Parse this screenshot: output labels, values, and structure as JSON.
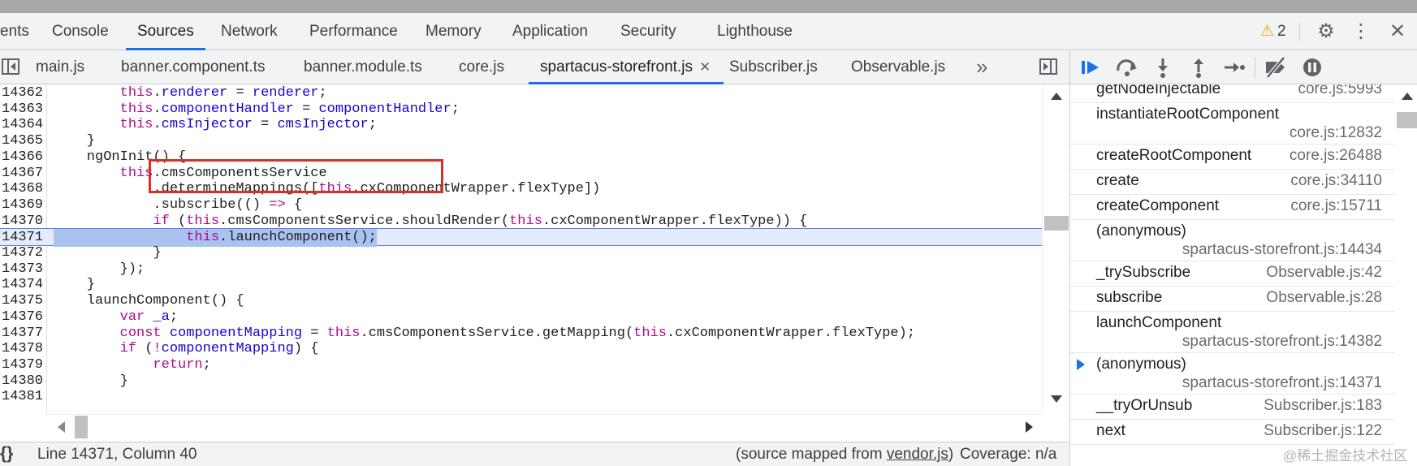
{
  "main_tabs": [
    "ents",
    "Console",
    "Sources",
    "Network",
    "Performance",
    "Memory",
    "Application",
    "Security",
    "Lighthouse"
  ],
  "active_main_tab": "Sources",
  "warnings_count": "2",
  "file_tabs": [
    "main.js",
    "banner.component.ts",
    "banner.module.ts",
    "core.js",
    "spartacus-storefront.js",
    "Subscriber.js",
    "Observable.js"
  ],
  "active_file_tab": "spartacus-storefront.js",
  "more_tabs_glyph": "»",
  "code_lines": [
    {
      "num": "14362",
      "code": "        this.renderer = renderer;"
    },
    {
      "num": "14363",
      "code": "        this.componentHandler = componentHandler;"
    },
    {
      "num": "14364",
      "code": "        this.cmsInjector = cmsInjector;"
    },
    {
      "num": "14365",
      "code": "    }"
    },
    {
      "num": "14366",
      "code": "    ngOnInit() {"
    },
    {
      "num": "14367",
      "code": "        this.cmsComponentsService"
    },
    {
      "num": "14368",
      "code": "            .determineMappings([this.cxComponentWrapper.flexType])"
    },
    {
      "num": "14369",
      "code": "            .subscribe(() => {"
    },
    {
      "num": "14370",
      "code": "            if (this.cmsComponentsService.shouldRender(this.cxComponentWrapper.flexType)) {"
    },
    {
      "num": "14371",
      "code": "                this.launchComponent();"
    },
    {
      "num": "14372",
      "code": "            }"
    },
    {
      "num": "14373",
      "code": "        });"
    },
    {
      "num": "14374",
      "code": "    }"
    },
    {
      "num": "14375",
      "code": "    launchComponent() {"
    },
    {
      "num": "14376",
      "code": "        var _a;"
    },
    {
      "num": "14377",
      "code": "        const componentMapping = this.cmsComponentsService.getMapping(this.cxComponentWrapper.flexType);"
    },
    {
      "num": "14378",
      "code": "        if (!componentMapping) {"
    },
    {
      "num": "14379",
      "code": "            return;"
    },
    {
      "num": "14380",
      "code": "        }"
    },
    {
      "num": "14381",
      "code": ""
    }
  ],
  "paused_line": "14371",
  "status": {
    "braces": "{}",
    "position": "Line 14371, Column 40",
    "source_prefix": "(source mapped from ",
    "source_file": "vendor.js",
    "source_suffix": ")",
    "coverage": "Coverage: n/a"
  },
  "call_stack": [
    {
      "fn": "getNodeInjectable",
      "loc": "core.js:5993",
      "wrap": false,
      "current": false
    },
    {
      "fn": "instantiateRootComponent",
      "loc": "core.js:12832",
      "wrap": true,
      "current": false
    },
    {
      "fn": "createRootComponent",
      "loc": "core.js:26488",
      "wrap": false,
      "current": false
    },
    {
      "fn": "create",
      "loc": "core.js:34110",
      "wrap": false,
      "current": false
    },
    {
      "fn": "createComponent",
      "loc": "core.js:15711",
      "wrap": false,
      "current": false
    },
    {
      "fn": "(anonymous)",
      "loc": "spartacus-storefront.js:14434",
      "wrap": true,
      "current": false
    },
    {
      "fn": "_trySubscribe",
      "loc": "Observable.js:42",
      "wrap": false,
      "current": false
    },
    {
      "fn": "subscribe",
      "loc": "Observable.js:28",
      "wrap": false,
      "current": false
    },
    {
      "fn": "launchComponent",
      "loc": "spartacus-storefront.js:14382",
      "wrap": true,
      "current": false
    },
    {
      "fn": "(anonymous)",
      "loc": "spartacus-storefront.js:14371",
      "wrap": true,
      "current": true
    },
    {
      "fn": "__tryOrUnsub",
      "loc": "Subscriber.js:183",
      "wrap": false,
      "current": false
    },
    {
      "fn": "next",
      "loc": "Subscriber.js:122",
      "wrap": false,
      "current": false
    }
  ],
  "watermark": "@稀土掘金技术社区",
  "colors": {
    "accent": "#1a73e8",
    "highlight_box": "#d93025",
    "paused_line_bg": "#a9c2ef",
    "keyword": "#aa0d91",
    "variable": "#1c00cf",
    "warning": "#e8a400"
  }
}
